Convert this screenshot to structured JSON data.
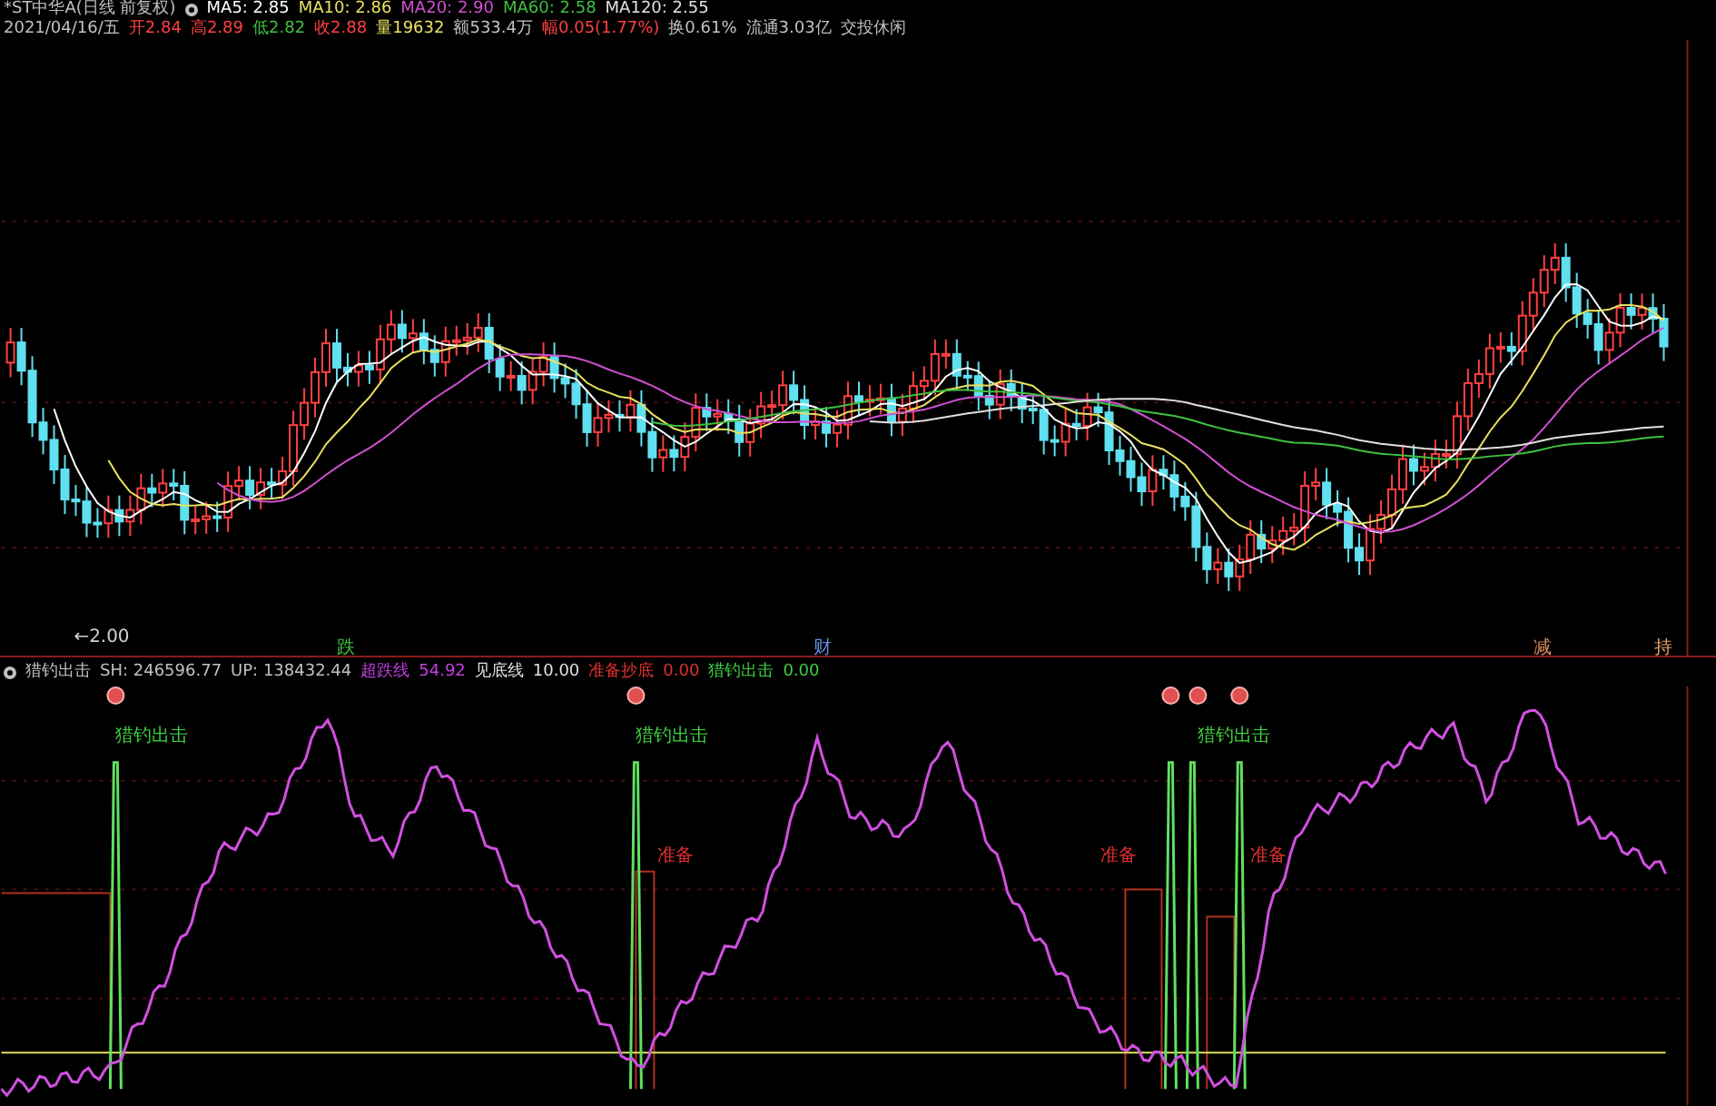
{
  "quote_header": {
    "title": "*ST中华A(日线 前复权)",
    "moving_averages": [
      {
        "label": "MA5: 2.85",
        "color": "#ffffff"
      },
      {
        "label": "MA10: 2.86",
        "color": "#e8e060"
      },
      {
        "label": "MA20: 2.90",
        "color": "#d050d0"
      },
      {
        "label": "MA60: 2.58",
        "color": "#40c040"
      },
      {
        "label": "MA120: 2.55",
        "color": "#e0e0e0"
      }
    ],
    "stats": [
      {
        "label": "2021/04/16/五",
        "color": "#c0c0c0"
      },
      {
        "label": "开2.84",
        "color": "#ff4040"
      },
      {
        "label": "高2.89",
        "color": "#ff4040"
      },
      {
        "label": "低2.82",
        "color": "#40c040"
      },
      {
        "label": "收2.88",
        "color": "#ff4040"
      },
      {
        "label": "量19632",
        "color": "#e8e060"
      },
      {
        "label": "额533.4万",
        "color": "#c0c0c0"
      },
      {
        "label": "幅0.05(1.77%)",
        "color": "#ff4040"
      },
      {
        "label": "换0.61%",
        "color": "#c0c0c0"
      },
      {
        "label": "流通3.03亿",
        "color": "#c0c0c0"
      },
      {
        "label": "交投休闲",
        "color": "#c0c0c0"
      }
    ]
  },
  "price_chart": {
    "low_marker": "←2.00",
    "event_tags": [
      {
        "label": "跌",
        "color": "#40c040"
      },
      {
        "label": "财",
        "color": "#6090e0"
      },
      {
        "label": "减",
        "color": "#e09060"
      },
      {
        "label": "持",
        "color": "#e0a060"
      }
    ]
  },
  "indicator_header": {
    "name": "猎钓出击",
    "values": [
      {
        "label": "SH: 246596.77",
        "color": "#c0c0c0"
      },
      {
        "label": "UP: 138432.44",
        "color": "#c0c0c0"
      },
      {
        "label": "超跌线",
        "color": "#c040e0"
      },
      {
        "label": "54.92",
        "color": "#c040e0"
      },
      {
        "label": "见底线",
        "color": "#e0e0e0"
      },
      {
        "label": "10.00",
        "color": "#e0e0e0"
      },
      {
        "label": "准备抄底",
        "color": "#e03030"
      },
      {
        "label": "0.00",
        "color": "#e03030"
      },
      {
        "label": "猎钓出击",
        "color": "#40d040"
      },
      {
        "label": "0.00",
        "color": "#40d040"
      }
    ]
  },
  "indicator_chart": {
    "signal_labels": [
      {
        "label": "猎钓出击",
        "kind": "buy"
      },
      {
        "label": "猎钓出击",
        "kind": "buy"
      },
      {
        "label": "猎钓出击",
        "kind": "buy"
      },
      {
        "label": "准备",
        "kind": "ready"
      },
      {
        "label": "准备",
        "kind": "ready"
      },
      {
        "label": "准备",
        "kind": "ready"
      }
    ]
  }
}
